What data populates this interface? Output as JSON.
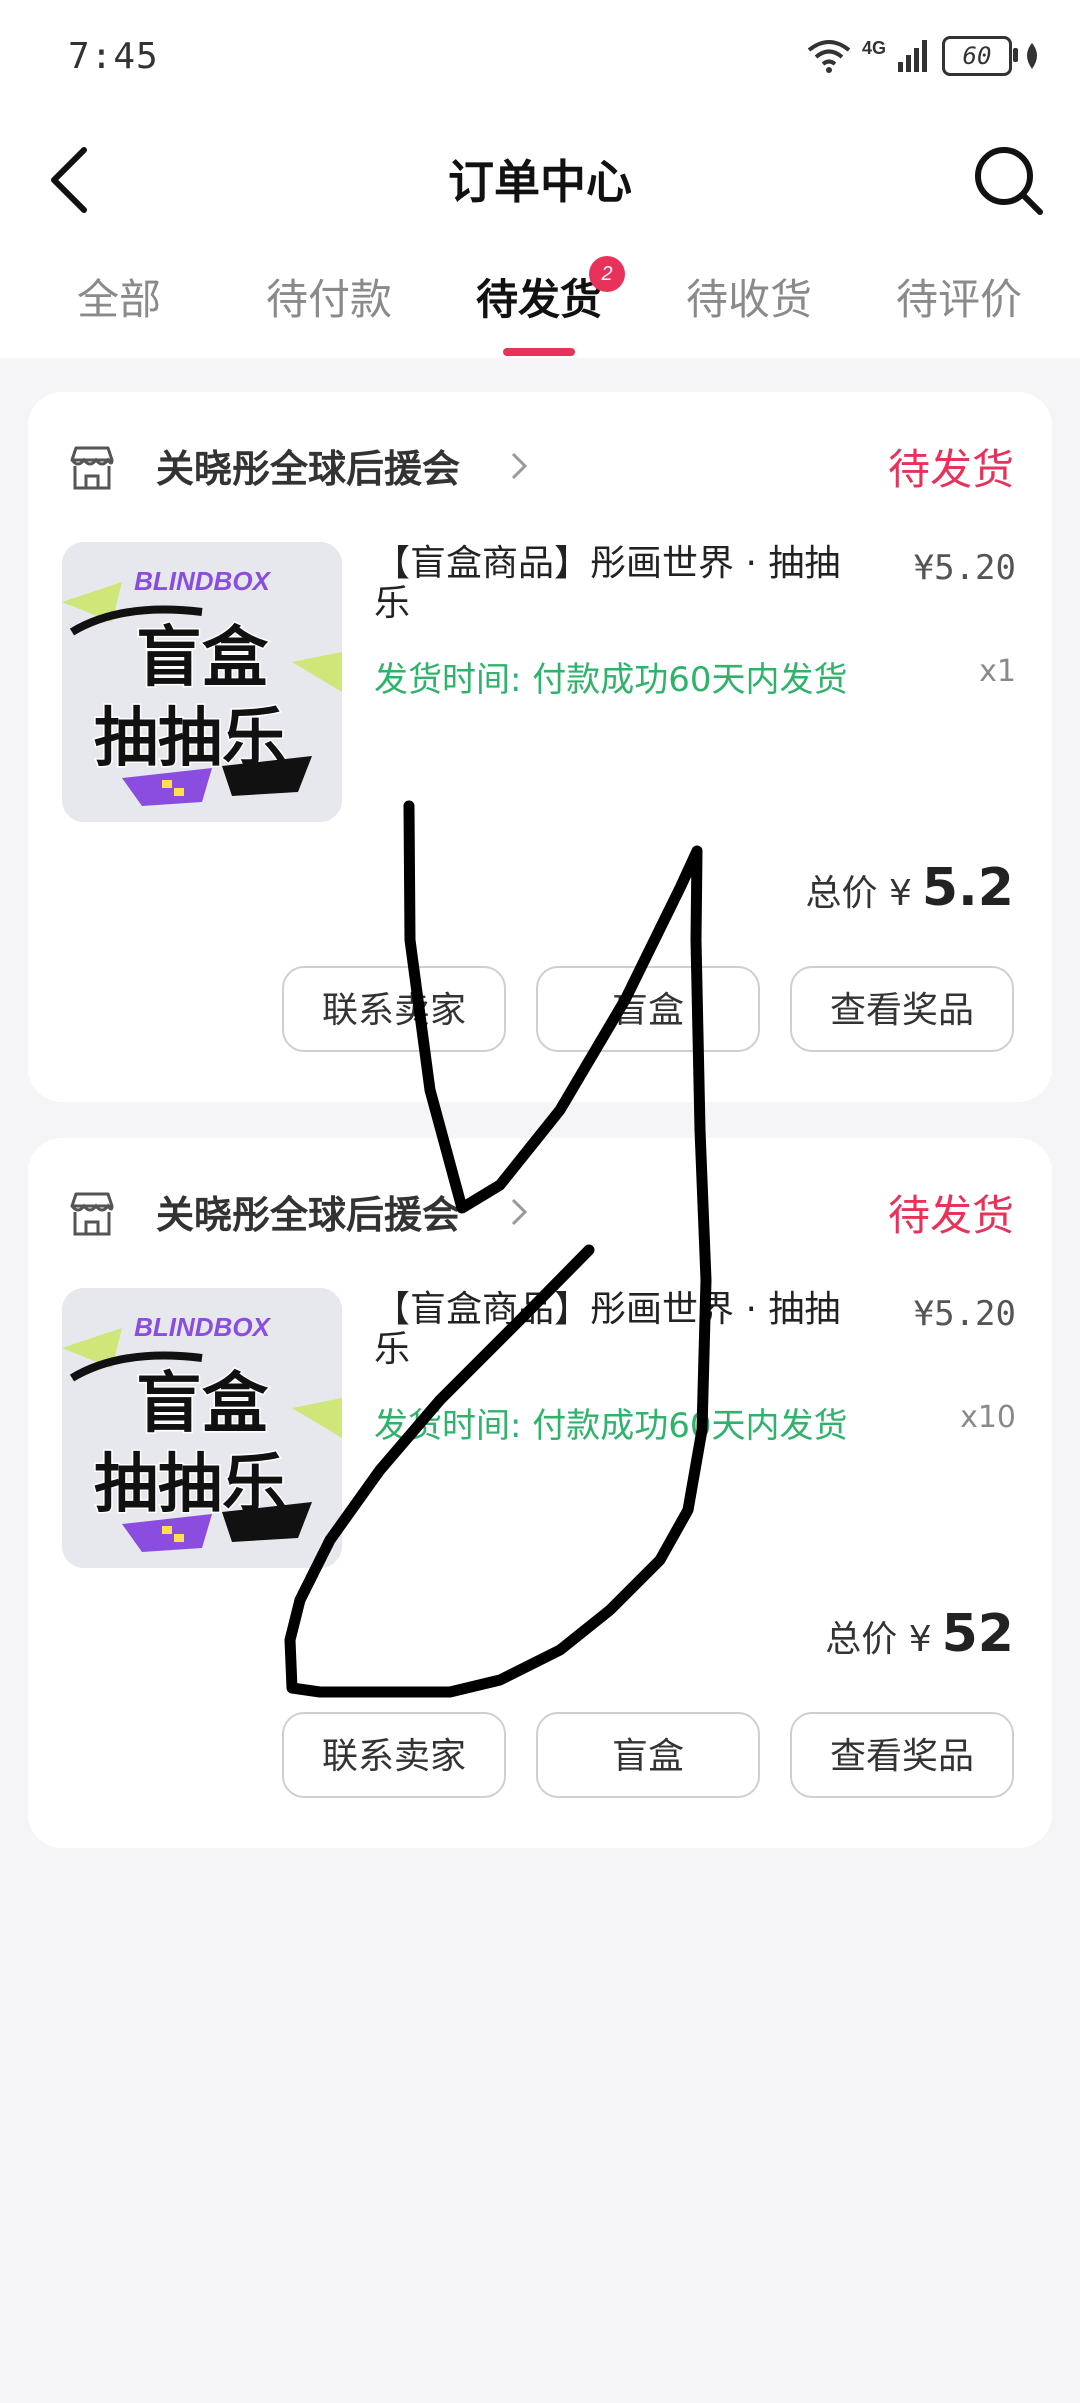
{
  "status_bar": {
    "time": "7:45",
    "network": "4G",
    "battery": "60"
  },
  "header": {
    "title": "订单中心"
  },
  "tabs": [
    {
      "label": "全部"
    },
    {
      "label": "待付款"
    },
    {
      "label": "待发货",
      "badge": "2"
    },
    {
      "label": "待收货"
    },
    {
      "label": "待评价"
    }
  ],
  "orders": [
    {
      "shop_name": "关晓彤全球后援会",
      "status": "待发货",
      "product_name": "【盲盒商品】彤画世界 · 抽抽乐",
      "price": "¥5.20",
      "ship_time": "发货时间: 付款成功60天内发货",
      "quantity": "x1",
      "total_label": "总价 ¥",
      "total_value": "5.2",
      "buttons": [
        "联系卖家",
        "盲盒",
        "查看奖品"
      ]
    },
    {
      "shop_name": "关晓彤全球后援会",
      "status": "待发货",
      "product_name": "【盲盒商品】彤画世界 · 抽抽乐",
      "price": "¥5.20",
      "ship_time": "发货时间: 付款成功60天内发货",
      "quantity": "x10",
      "total_label": "总价 ¥",
      "total_value": "52",
      "buttons": [
        "联系卖家",
        "盲盒",
        "查看奖品"
      ]
    }
  ],
  "thumbnail": {
    "brand": "BLINDBOX",
    "line1": "盲盒",
    "line2": "抽抽乐"
  }
}
